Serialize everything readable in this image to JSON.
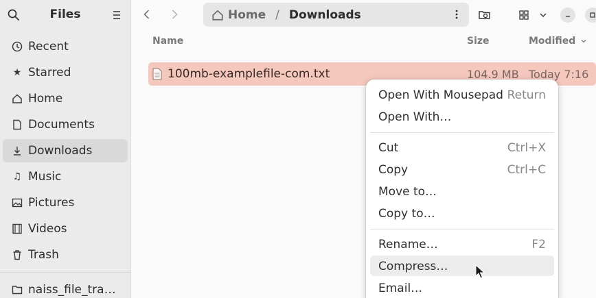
{
  "sidebar": {
    "title": "Files",
    "items": [
      {
        "label": "Recent",
        "icon": "clock-icon"
      },
      {
        "label": "Starred",
        "icon": "star-icon"
      },
      {
        "label": "Home",
        "icon": "home-icon"
      },
      {
        "label": "Documents",
        "icon": "document-icon"
      },
      {
        "label": "Downloads",
        "icon": "download-icon",
        "active": true
      },
      {
        "label": "Music",
        "icon": "music-icon"
      },
      {
        "label": "Pictures",
        "icon": "picture-icon"
      },
      {
        "label": "Videos",
        "icon": "video-icon"
      },
      {
        "label": "Trash",
        "icon": "trash-icon"
      }
    ],
    "bookmark": {
      "label": "naiss_file_tra…",
      "icon": "folder-icon"
    }
  },
  "header": {
    "path": {
      "home": "Home",
      "separator": "/",
      "current": "Downloads"
    }
  },
  "columns": {
    "name": "Name",
    "size": "Size",
    "modified": "Modified"
  },
  "files": [
    {
      "name": "100mb-examplefile-com.txt",
      "size": "104.9 MB",
      "modified": "Today 7:16",
      "selected": true
    }
  ],
  "context_menu": {
    "items": [
      {
        "label": "Open With Mousepad",
        "shortcut": "Return"
      },
      {
        "label": "Open With…",
        "shortcut": ""
      },
      {
        "label": "Cut",
        "shortcut": "Ctrl+X"
      },
      {
        "label": "Copy",
        "shortcut": "Ctrl+C"
      },
      {
        "label": "Move to…",
        "shortcut": ""
      },
      {
        "label": "Copy to…",
        "shortcut": ""
      },
      {
        "label": "Rename…",
        "shortcut": "F2"
      },
      {
        "label": "Compress…",
        "shortcut": "",
        "hovered": true
      },
      {
        "label": "Email…",
        "shortcut": ""
      }
    ]
  },
  "colors": {
    "selection": "#f4c8bd",
    "sidebar_bg": "#ebebeb",
    "active_item": "#d9d9d9"
  }
}
